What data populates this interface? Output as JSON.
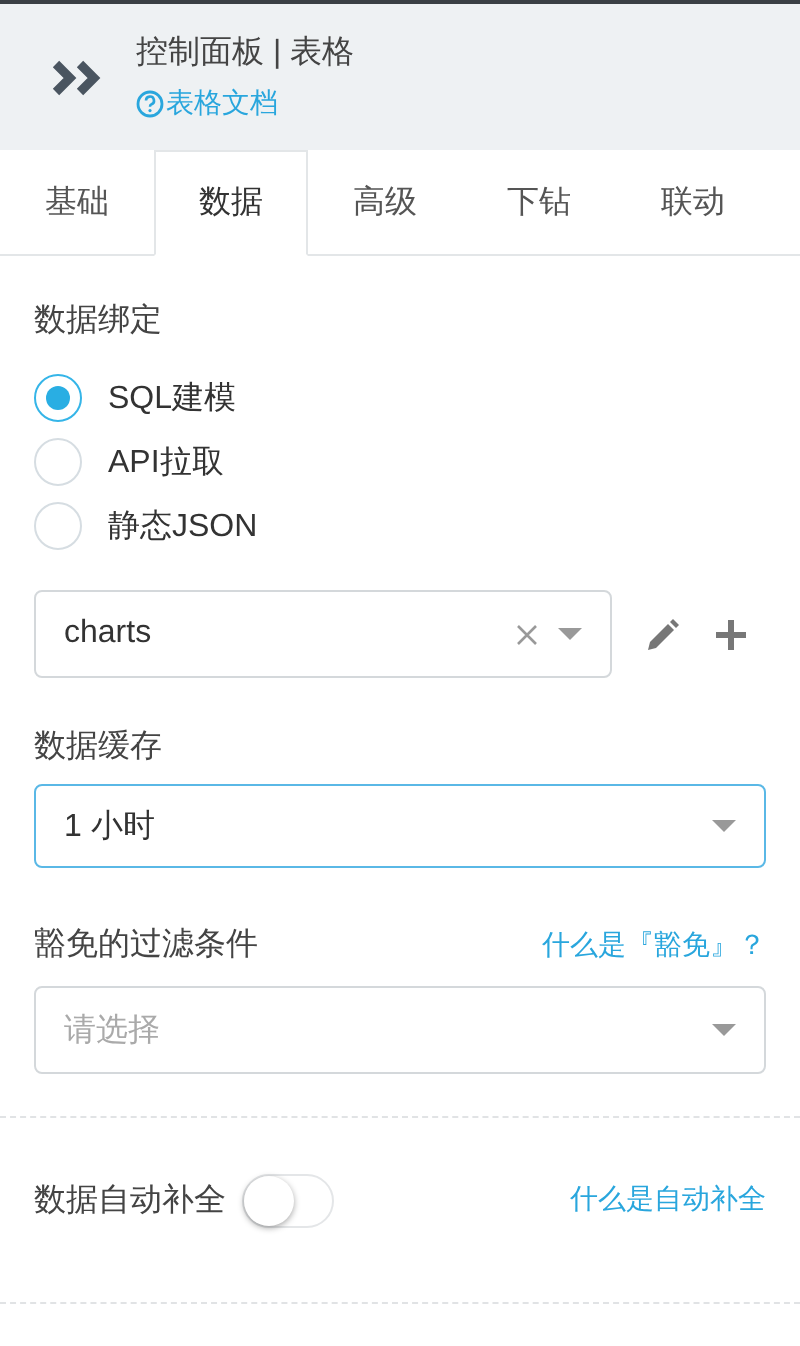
{
  "header": {
    "title": "控制面板 | 表格",
    "doc_link": "表格文档"
  },
  "tabs": [
    {
      "label": "基础",
      "selected": false
    },
    {
      "label": "数据",
      "selected": true
    },
    {
      "label": "高级",
      "selected": false
    },
    {
      "label": "下钻",
      "selected": false
    },
    {
      "label": "联动",
      "selected": false
    }
  ],
  "data_binding": {
    "label": "数据绑定",
    "options": [
      {
        "label": "SQL建模",
        "selected": true
      },
      {
        "label": "API拉取",
        "selected": false
      },
      {
        "label": "静态JSON",
        "selected": false
      }
    ],
    "source_select": {
      "value": "charts"
    }
  },
  "cache": {
    "label": "数据缓存",
    "select": {
      "value": "1 小时",
      "focused": true
    }
  },
  "exempt_filter": {
    "label": "豁免的过滤条件",
    "help_link": "什么是『豁免』？",
    "select": {
      "placeholder": "请选择"
    }
  },
  "auto_complete": {
    "label": "数据自动补全",
    "on": false,
    "help_link": "什么是自动补全"
  }
}
